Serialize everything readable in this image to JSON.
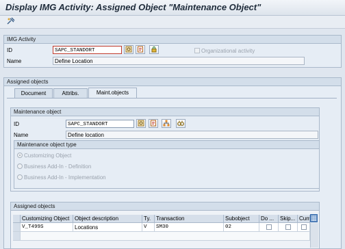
{
  "window": {
    "title": "Display IMG Activity: Assigned Object \"Maintenance Object\""
  },
  "toolbar": {
    "icon": "other-object-icon"
  },
  "img_activity": {
    "heading": "IMG Activity",
    "id_label": "ID",
    "id_value": "SAPC_STANDORT",
    "name_label": "Name",
    "name_value": "Define Location",
    "org_activity_label": "Organizational activity",
    "org_activity_checked": false
  },
  "assigned_objects": {
    "heading": "Assigned objects",
    "tabs": [
      {
        "label": "Document",
        "active": false
      },
      {
        "label": "Attribs.",
        "active": false
      },
      {
        "label": "Maint.objects",
        "active": true
      }
    ]
  },
  "maintenance_object": {
    "heading": "Maintenance object",
    "id_label": "ID",
    "id_value": "SAPC_STANDORT",
    "name_label": "Name",
    "name_value": "Define location",
    "type_heading": "Maintenance object type",
    "types": [
      {
        "label": "Customizing Object",
        "selected": true
      },
      {
        "label": "Business Add-In - Definition",
        "selected": false
      },
      {
        "label": "Business Add-In - Implementation",
        "selected": false
      }
    ]
  },
  "objects_table": {
    "heading": "Assigned objects",
    "columns": [
      "Customizing Object",
      "Object description",
      "Ty.",
      "Transaction",
      "Subobject",
      "Do ...",
      "Skip...",
      "Curr..."
    ],
    "rows": [
      [
        "V_T499S",
        "Locations",
        "V",
        "SM30",
        "02",
        "",
        "",
        ""
      ]
    ]
  },
  "colors": {
    "accent": "#3b5f88",
    "background": "#dfe6ef"
  }
}
